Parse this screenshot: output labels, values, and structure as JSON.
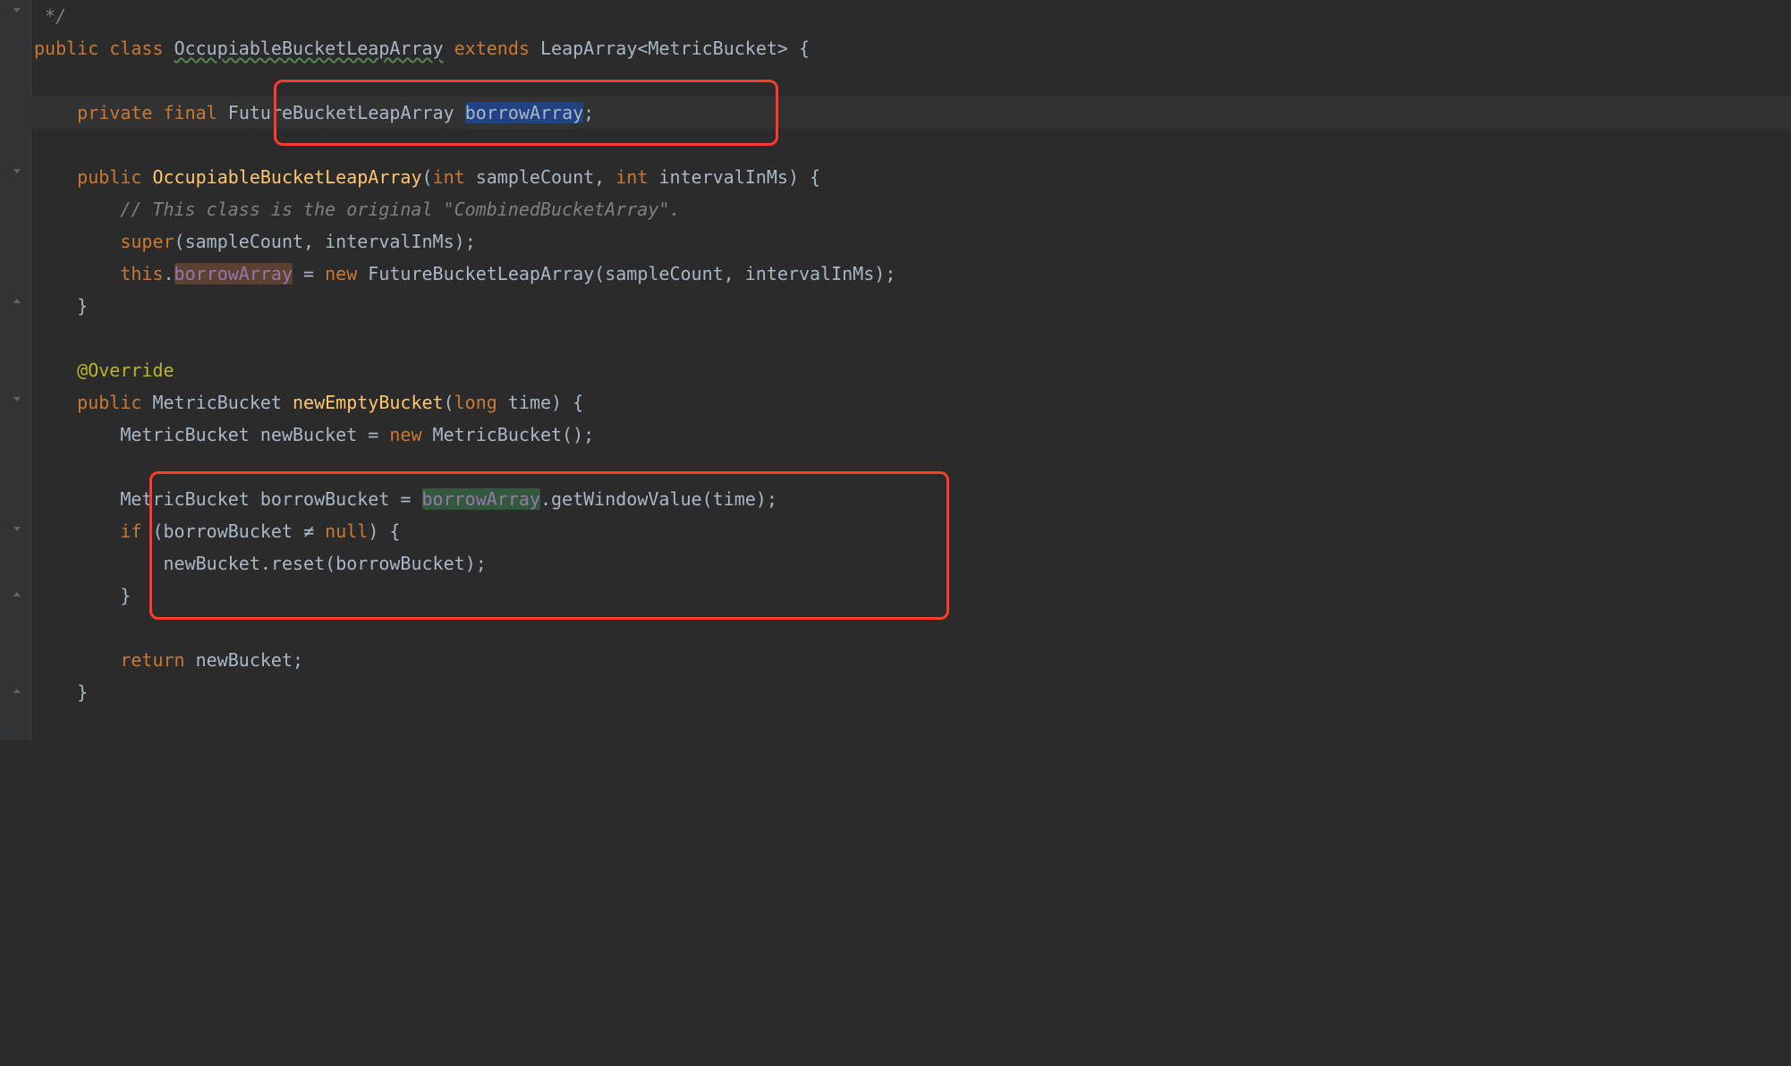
{
  "gutter": {
    "fold_icons": [
      0,
      180,
      328,
      436,
      590,
      662,
      770
    ]
  },
  "lines": {
    "l0": " */",
    "kw_public": "public",
    "kw_class": "class",
    "kw_extends": "extends",
    "kw_private": "private",
    "kw_final": "final",
    "kw_int": "int",
    "kw_long": "long",
    "kw_new": "new",
    "kw_null": "null",
    "kw_if": "if",
    "kw_return": "return",
    "kw_this": "this",
    "kw_super": "super",
    "cls_OccupiableBucketLeapArray": "OccupiableBucketLeapArray",
    "cls_LeapArray": "LeapArray",
    "cls_MetricBucket": "MetricBucket",
    "cls_FutureBucketLeapArray": "FutureBucketLeapArray",
    "field_borrowArray": "borrowArray",
    "param_sampleCount": "sampleCount",
    "param_intervalInMs": "intervalInMs",
    "comment_combined": "// This class is the original \"CombinedBucketArray\".",
    "anno_Override": "@Override",
    "method_newEmptyBucket": "newEmptyBucket",
    "param_time": "time",
    "var_newBucket": "newBucket",
    "var_borrowBucket": "borrowBucket",
    "call_getWindowValue": "getWindowValue",
    "call_reset": "reset",
    "neq": "≠",
    "brace_open": "{",
    "brace_close": "}",
    "semicolon": ";",
    "lt": "<",
    "gt": ">",
    "paren_open": "(",
    "paren_close": ")",
    "comma": ",",
    "dot": ".",
    "eq": " = "
  }
}
